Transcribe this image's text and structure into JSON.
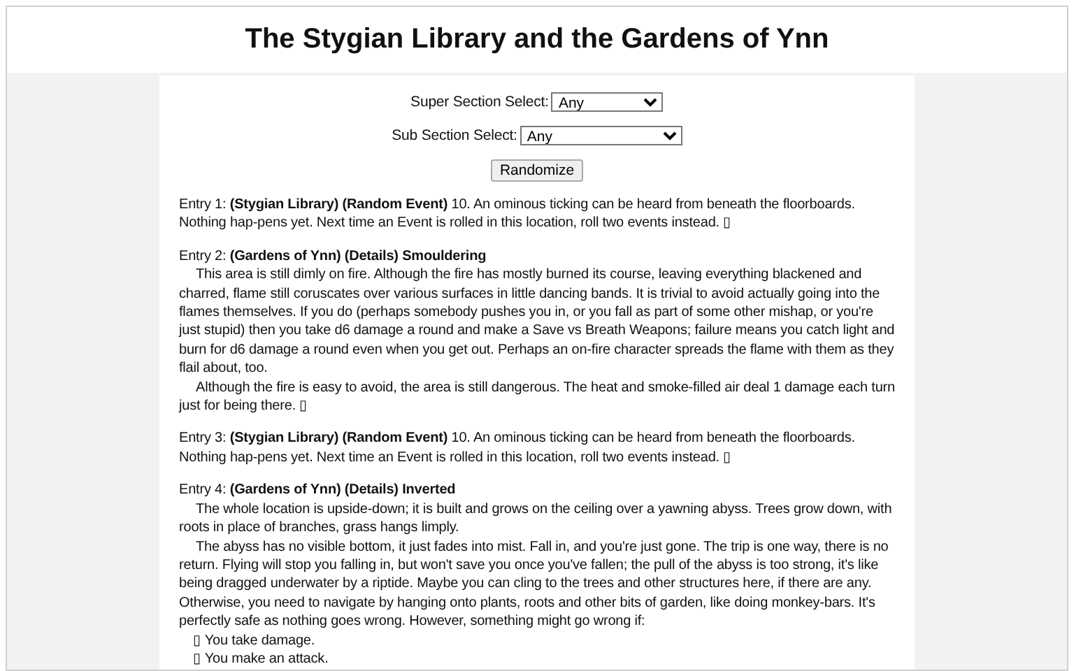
{
  "title": "The Stygian Library and the Gardens of Ynn",
  "controls": [
    {
      "label": "Super Section Select:",
      "value": "Any",
      "kind": "narrow"
    },
    {
      "label": "Sub Section Select:",
      "value": "Any",
      "kind": "wide"
    }
  ],
  "button": "Randomize",
  "entries": [
    {
      "blocks": [
        {
          "kind": "para",
          "text": "Entry 1: **(Stygian Library) (Random Event)** 10. An ominous ticking can be heard from beneath the floorboards. Nothing hap-pens yet. Next time an Event is rolled in this location, roll two events instead. ▯"
        }
      ]
    },
    {
      "blocks": [
        {
          "kind": "para",
          "text": "Entry 2: **(Gardens of Ynn) (Details) Smouldering**"
        },
        {
          "kind": "indent",
          "text": "This area is still dimly on fire. Although the fire has mostly burned its course, leaving everything blackened and charred, flame still coruscates over various surfaces in little dancing bands. It is trivial to avoid actually going into the flames themselves. If you do (perhaps somebody pushes you in, or you fall as part of some other mishap, or you're just stupid) then you take d6 damage a round and make a Save vs Breath Weapons; failure means you catch light and burn for d6 damage a round even when you get out. Perhaps an on-fire character spreads the flame with them as they flail about, too."
        },
        {
          "kind": "indent",
          "text": "Although the fire is easy to avoid, the area is still dangerous. The heat and smoke-filled air deal 1 damage each turn just for being there. ▯"
        }
      ]
    },
    {
      "blocks": [
        {
          "kind": "para",
          "text": "Entry 3: **(Stygian Library) (Random Event)** 10. An ominous ticking can be heard from beneath the floorboards. Nothing hap-pens yet. Next time an Event is rolled in this location, roll two events instead. ▯"
        }
      ]
    },
    {
      "blocks": [
        {
          "kind": "para",
          "text": "Entry 4: **(Gardens of Ynn) (Details) Inverted**"
        },
        {
          "kind": "indent",
          "text": "The whole location is upside-down; it is built and grows on the ceiling over a yawning abyss. Trees grow down, with roots in place of branches, grass hangs limply."
        },
        {
          "kind": "indent",
          "text": "The abyss has no visible bottom, it just fades into mist. Fall in, and you're just gone. The trip is one way, there is no return. Flying will stop you falling in, but won't save you once you've fallen; the pull of the abyss is too strong, it's like being dragged underwater by a riptide. Maybe you can cling to the trees and other structures here, if there are any. Otherwise, you need to navigate by hanging onto plants, roots and other bits of garden, like doing monkey-bars. It's perfectly safe as nothing goes wrong. However, something might go wrong if:"
        },
        {
          "kind": "bullet",
          "text": "▯ You take damage."
        },
        {
          "kind": "bullet",
          "text": "▯ You make an attack."
        }
      ]
    }
  ]
}
